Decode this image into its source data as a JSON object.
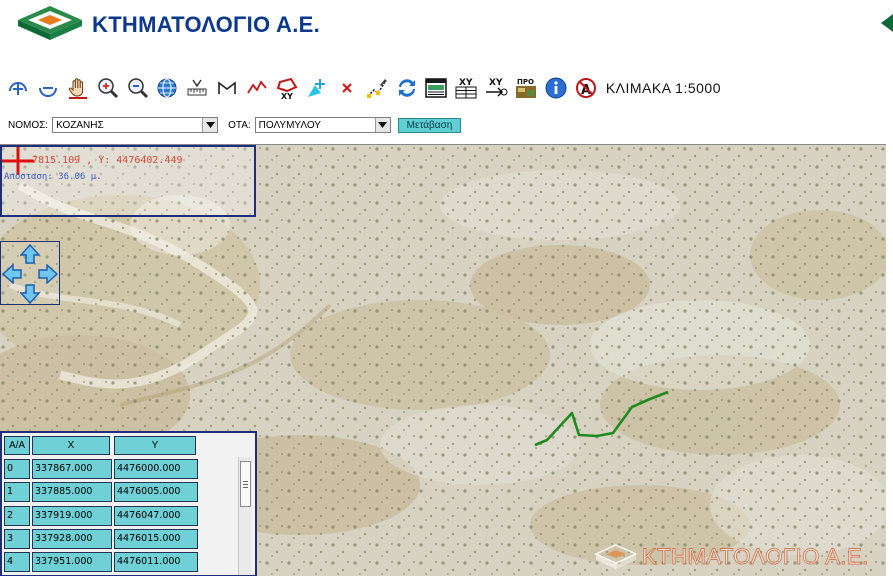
{
  "header": {
    "title": "ΚΤΗΜΑΤΟΛΟΓΙΟ Α.Ε.",
    "accent_green": "#0f6a3a",
    "accent_blue": "#0b3a8c"
  },
  "toolbar": {
    "tools": [
      "zoom-in-icon",
      "zoom-out-icon",
      "pan-hand-icon",
      "zoom-window-icon",
      "zoom-previous-icon",
      "full-extent-globe-icon",
      "measure-ruler-icon",
      "envelope-icon",
      "measure-line-icon",
      "polygon-xy-icon",
      "select-point-icon",
      "clear-delete-icon",
      "edit-vertices-icon",
      "refresh-icon",
      "print-map-icon",
      "xy-table-icon",
      "xy-goto-icon",
      "pro-layer-icon",
      "info-icon",
      "label-toggle-icon"
    ],
    "scale_label": "ΚΛΙΜΑΚΑ 1:5000"
  },
  "filters": {
    "nomos_label": "ΝΟΜΟΣ:",
    "nomos_value": "ΚΟΖΑΝΗΣ",
    "ota_label": "ΟΤΑ:",
    "ota_value": "ΠΟΛΥΜΥΛΟΥ",
    "go_label": "Μετάβαση"
  },
  "map": {
    "coordinates": "7815.109 , Y: 4476402.449",
    "distance": "Απόσταση: 36.06 μ.",
    "track_color": "#1f8a1f",
    "watermark": "ΚΤΗΜΑΤΟΛΟΓΙΟ Α.Ε."
  },
  "table": {
    "headers": [
      "Α/Α",
      "X",
      "Y"
    ],
    "rows": [
      [
        "0",
        "337867.000",
        "4476000.000"
      ],
      [
        "1",
        "337885.000",
        "4476005.000"
      ],
      [
        "2",
        "337919.000",
        "4476047.000"
      ],
      [
        "3",
        "337928.000",
        "4476015.000"
      ],
      [
        "4",
        "337951.000",
        "4476011.000"
      ]
    ]
  }
}
